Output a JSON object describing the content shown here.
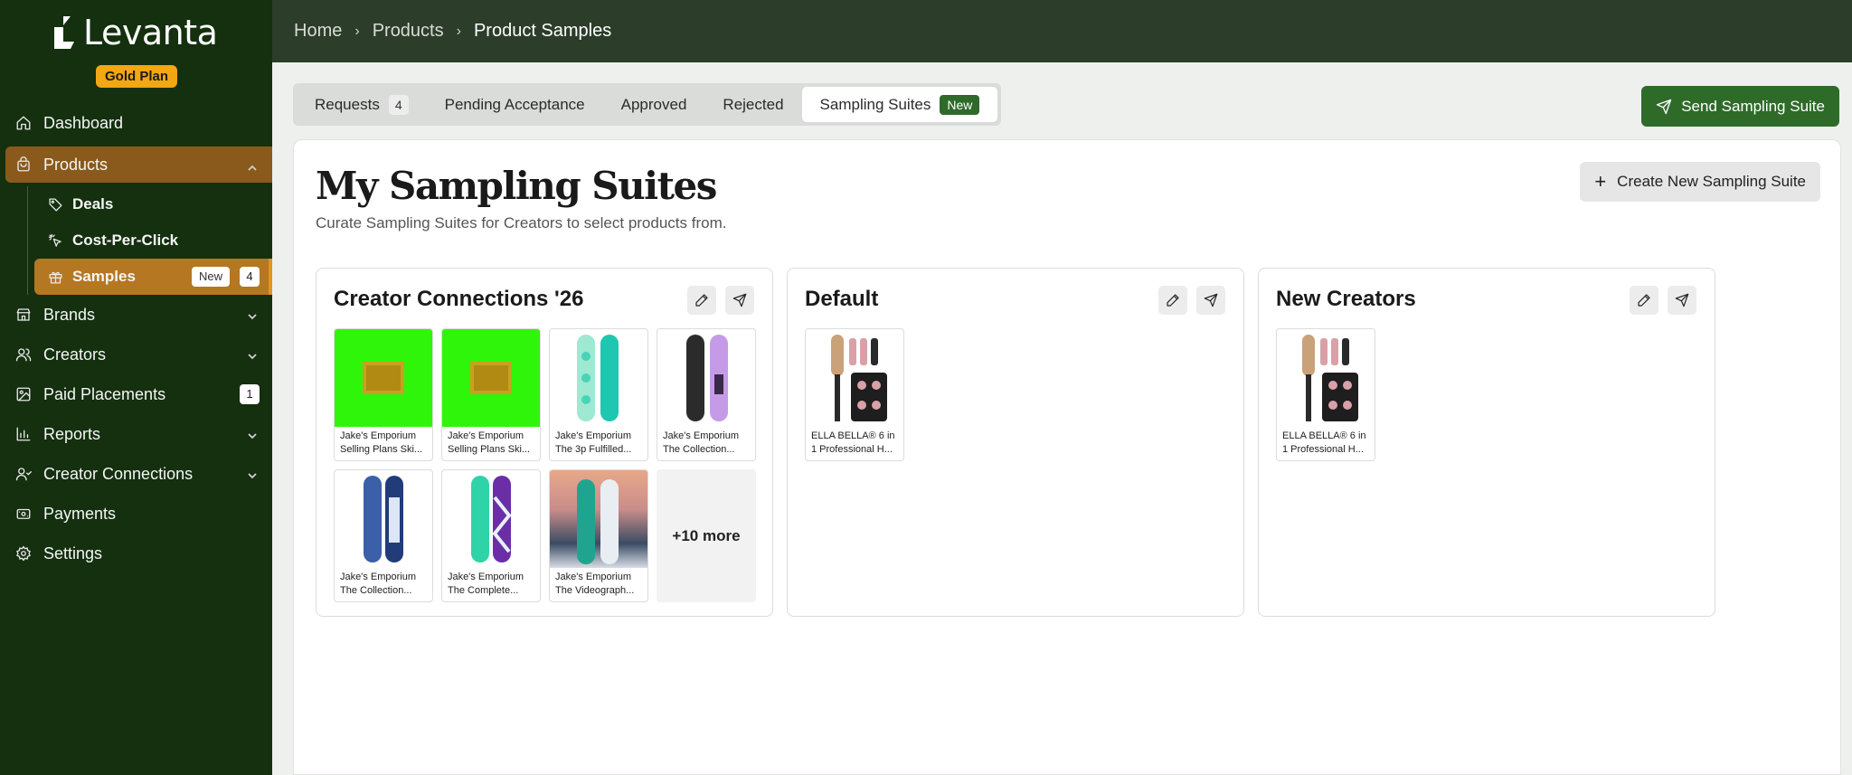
{
  "brand": {
    "name": "Levanta",
    "plan": "Gold Plan"
  },
  "sidebar": {
    "items": [
      {
        "label": "Dashboard"
      },
      {
        "label": "Products"
      },
      {
        "label": "Brands"
      },
      {
        "label": "Creators"
      },
      {
        "label": "Paid Placements",
        "count": "1"
      },
      {
        "label": "Reports"
      },
      {
        "label": "Creator Connections"
      },
      {
        "label": "Payments"
      },
      {
        "label": "Settings"
      }
    ],
    "products_sub": [
      {
        "label": "Deals"
      },
      {
        "label": "Cost-Per-Click"
      },
      {
        "label": "Samples",
        "badge": "New",
        "count": "4"
      }
    ]
  },
  "breadcrumb": {
    "home": "Home",
    "products": "Products",
    "current": "Product Samples",
    "separator": "›"
  },
  "tabs": [
    {
      "label": "Requests",
      "count": "4"
    },
    {
      "label": "Pending Acceptance"
    },
    {
      "label": "Approved"
    },
    {
      "label": "Rejected"
    },
    {
      "label": "Sampling Suites",
      "badge": "New"
    }
  ],
  "send_button": "Send Sampling Suite",
  "page": {
    "title": "My Sampling Suites",
    "subtitle": "Curate Sampling Suites for Creators to select products from.",
    "create_button": "Create New Sampling Suite"
  },
  "suites": [
    {
      "title": "Creator Connections '26",
      "products": [
        {
          "line1": "Jake's Emporium",
          "line2": "Selling Plans Ski..."
        },
        {
          "line1": "Jake's Emporium",
          "line2": "Selling Plans Ski..."
        },
        {
          "line1": "Jake's Emporium",
          "line2": "The 3p Fulfilled..."
        },
        {
          "line1": "Jake's Emporium",
          "line2": "The Collection..."
        },
        {
          "line1": "Jake's Emporium",
          "line2": "The Collection..."
        },
        {
          "line1": "Jake's Emporium",
          "line2": "The Complete..."
        },
        {
          "line1": "Jake's Emporium",
          "line2": "The Videograph..."
        }
      ],
      "more": "+10 more"
    },
    {
      "title": "Default",
      "products": [
        {
          "line1": "ELLA BELLA® 6 in",
          "line2": "1 Professional H..."
        }
      ]
    },
    {
      "title": "New Creators",
      "products": [
        {
          "line1": "ELLA BELLA® 6 in",
          "line2": "1 Professional H..."
        }
      ]
    }
  ],
  "colors": {
    "sidebar_bg": "#14300f",
    "header_bg": "#2c3d2a",
    "active_nav": "#8a5a1c",
    "active_sub": "#b57722",
    "plan_badge": "#f3a712",
    "primary_button": "#2e6b29",
    "product_green": "#2ff50a"
  }
}
